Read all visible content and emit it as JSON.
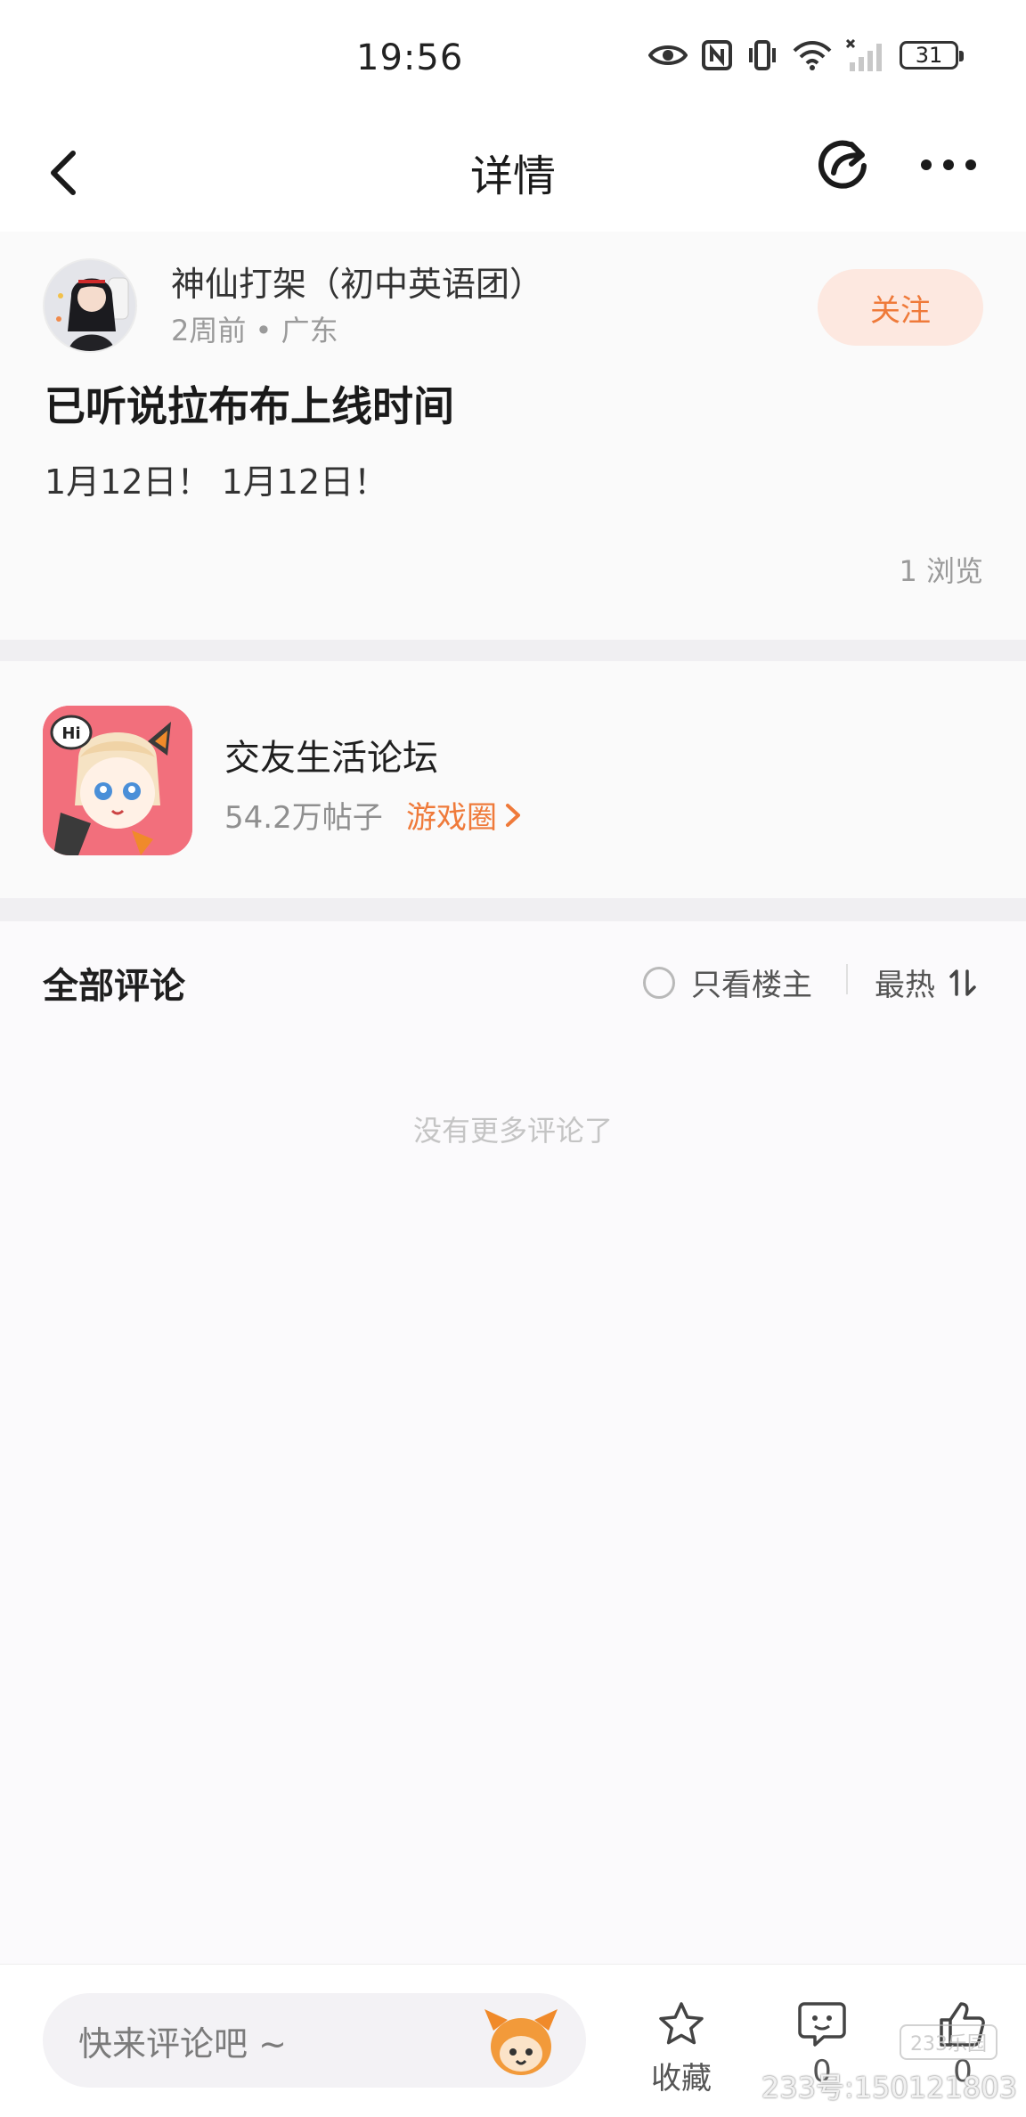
{
  "status_bar": {
    "time": "19:56",
    "battery": "31",
    "icons": [
      "eye-icon",
      "nfc-icon",
      "vibrate-icon",
      "wifi-icon",
      "signal-icon",
      "battery-icon"
    ]
  },
  "nav": {
    "title": "详情",
    "icons": [
      "back-icon",
      "share-icon",
      "more-icon"
    ]
  },
  "post": {
    "author_name": "神仙打架（初中英语团）",
    "author_meta": "2周前 • 广东",
    "follow_label": "关注",
    "title": "已听说拉布布上线时间",
    "body": "1月12日！ 1月12日！",
    "views": "1 浏览"
  },
  "forum": {
    "name": "交友生活论坛",
    "posts": "54.2万帖子",
    "link_label": "游戏圈",
    "icon_badge": "Hi"
  },
  "comments": {
    "title": "全部评论",
    "only_owner_label": "只看楼主",
    "sort_label": "最热",
    "empty_text": "没有更多评论了"
  },
  "bottom_bar": {
    "input_placeholder": "快来评论吧 ~",
    "favorite_label": "收藏",
    "comment_count": "0",
    "like_count": "0"
  },
  "watermark": {
    "badge": "233乐园",
    "text": "233号:150121803"
  },
  "colors": {
    "accent": "#ef7a3a",
    "follow_bg": "#fde8e0",
    "page_bg": "#f7f6f8"
  }
}
